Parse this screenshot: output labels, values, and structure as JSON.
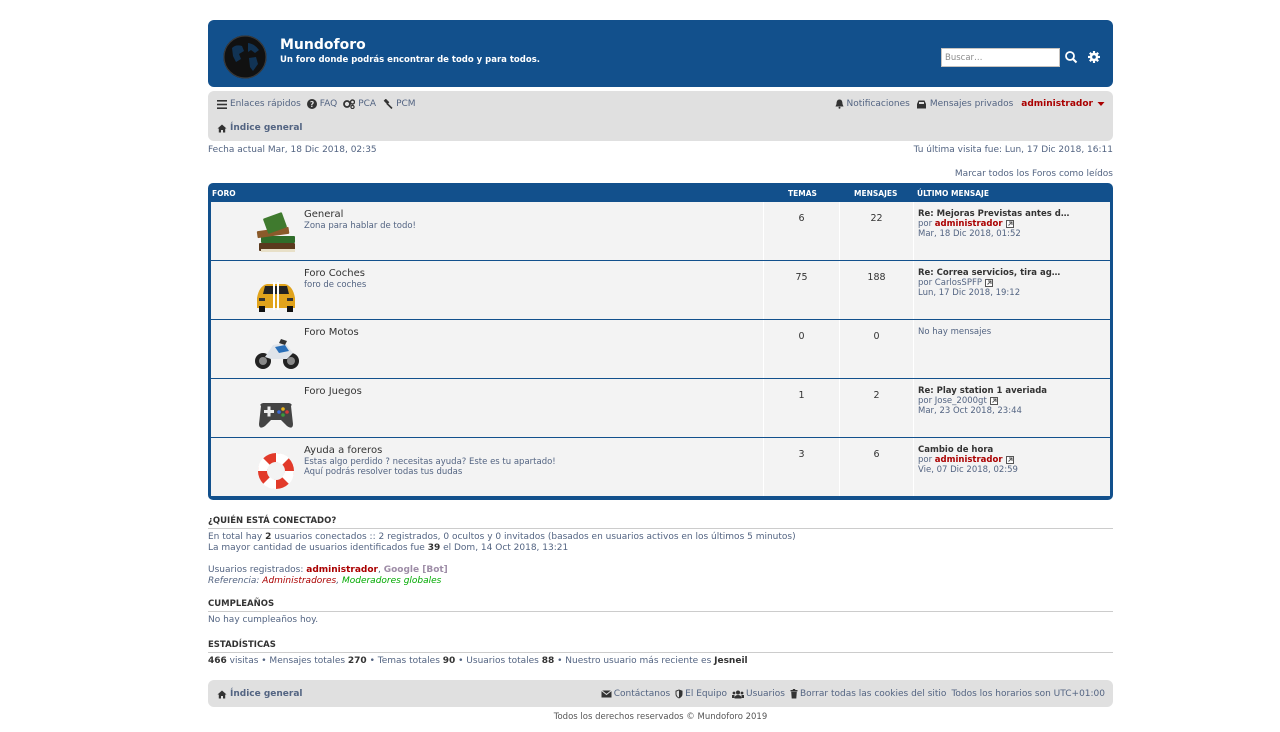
{
  "header": {
    "site_title": "Mundoforo",
    "site_description": "Un foro donde podrás encontrar de todo y para todos.",
    "search_placeholder": "Buscar…",
    "colors": {
      "header_bg": "#12508c",
      "nav_bg": "#e0e0e0",
      "admin_color": "#aa0000",
      "mods_color": "#00aa00"
    }
  },
  "nav": {
    "quick_links": "Enlaces rápidos",
    "faq": "FAQ",
    "acp": "PCA",
    "mcp": "PCM",
    "notifications": "Notificaciones",
    "private_messages": "Mensajes privados",
    "username": "administrador",
    "breadcrumb": "Índice general"
  },
  "info": {
    "current_date": "Fecha actual Mar, 18 Dic 2018, 02:35",
    "last_visit": "Tu última visita fue: Lun, 17 Dic 2018, 16:11",
    "mark_read": "Marcar todos los Foros como leídos"
  },
  "forum_table": {
    "headers": {
      "forum": "FORO",
      "topics": "TEMAS",
      "posts": "MENSAJES",
      "last_post": "ÚLTIMO MENSAJE"
    },
    "rows": [
      {
        "title": "General",
        "desc1": "Zona para hablar de todo!",
        "desc2": "",
        "icon": "books-icon",
        "topics": "6",
        "posts": "22",
        "last_title": "Re: Mejoras Previstas antes d…",
        "last_by_prefix": "por ",
        "last_by": "administrador",
        "last_by_admin": true,
        "last_date": "Mar, 18 Dic 2018, 01:52"
      },
      {
        "title": "Foro Coches",
        "desc1": "foro de coches",
        "desc2": "",
        "icon": "car-icon",
        "topics": "75",
        "posts": "188",
        "last_title": "Re: Correa servicios, tira ag…",
        "last_by_prefix": "por ",
        "last_by": "CarlosSPFP",
        "last_by_admin": false,
        "last_date": "Lun, 17 Dic 2018, 19:12"
      },
      {
        "title": "Foro Motos",
        "desc1": "",
        "desc2": "",
        "icon": "motorcycle-icon",
        "topics": "0",
        "posts": "0",
        "last_title": "",
        "last_by_prefix": "",
        "last_by": "",
        "last_by_admin": false,
        "last_date": "",
        "no_posts": "No hay mensajes"
      },
      {
        "title": "Foro Juegos",
        "desc1": "",
        "desc2": "",
        "icon": "gamepad-icon",
        "topics": "1",
        "posts": "2",
        "last_title": "Re: Play station 1 averiada",
        "last_by_prefix": "por ",
        "last_by": "Jose_2000gt",
        "last_by_admin": false,
        "last_date": "Mar, 23 Oct 2018, 23:44"
      },
      {
        "title": "Ayuda a foreros",
        "desc1": "Estas algo perdido ? necesitas ayuda? Este es tu apartado!",
        "desc2": "Aquí podrás resolver todas tus dudas",
        "icon": "lifebuoy-icon",
        "topics": "3",
        "posts": "6",
        "last_title": "Cambio de hora",
        "last_by_prefix": "por ",
        "last_by": "administrador",
        "last_by_admin": true,
        "last_date": "Vie, 07 Dic 2018, 02:59"
      }
    ]
  },
  "online": {
    "title": "¿QUIÉN ESTÁ CONECTADO?",
    "line1_a": "En total hay ",
    "line1_count": "2",
    "line1_b": " usuarios conectados :: 2 registrados, 0 ocultos y 0 invitados (basados en usuarios activos en los últimos 5 minutos)",
    "line2_a": "La mayor cantidad de usuarios identificados fue ",
    "line2_count": "39",
    "line2_b": " el Dom, 14 Oct 2018, 13:21",
    "registered_label": "Usuarios registrados: ",
    "user1": "administrador",
    "sep": ", ",
    "user2": "Google [Bot]",
    "legend_label": "Referencia: ",
    "legend_admins": "Administradores",
    "legend_sep": ", ",
    "legend_mods": "Moderadores globales"
  },
  "birthdays": {
    "title": "CUMPLEAÑOS",
    "text": "No hay cumpleaños hoy."
  },
  "stats": {
    "title": "ESTADÍSTICAS",
    "visits": "466",
    "visits_label": " visitas • Mensajes totales ",
    "posts": "270",
    "topics_label": " • Temas totales ",
    "topics": "90",
    "users_label": " • Usuarios totales ",
    "users": "88",
    "newest_label": " • Nuestro usuario más reciente es ",
    "newest": "Jesneil"
  },
  "footer": {
    "breadcrumb": "Índice general",
    "contact": "Contáctanos",
    "team": "El Equipo",
    "members": "Usuarios",
    "cookies": "Borrar todas las cookies del sitio",
    "timezone": "Todos los horarios son UTC+01:00",
    "copyright": "Todos los derechos reservados © Mundoforo 2019"
  }
}
